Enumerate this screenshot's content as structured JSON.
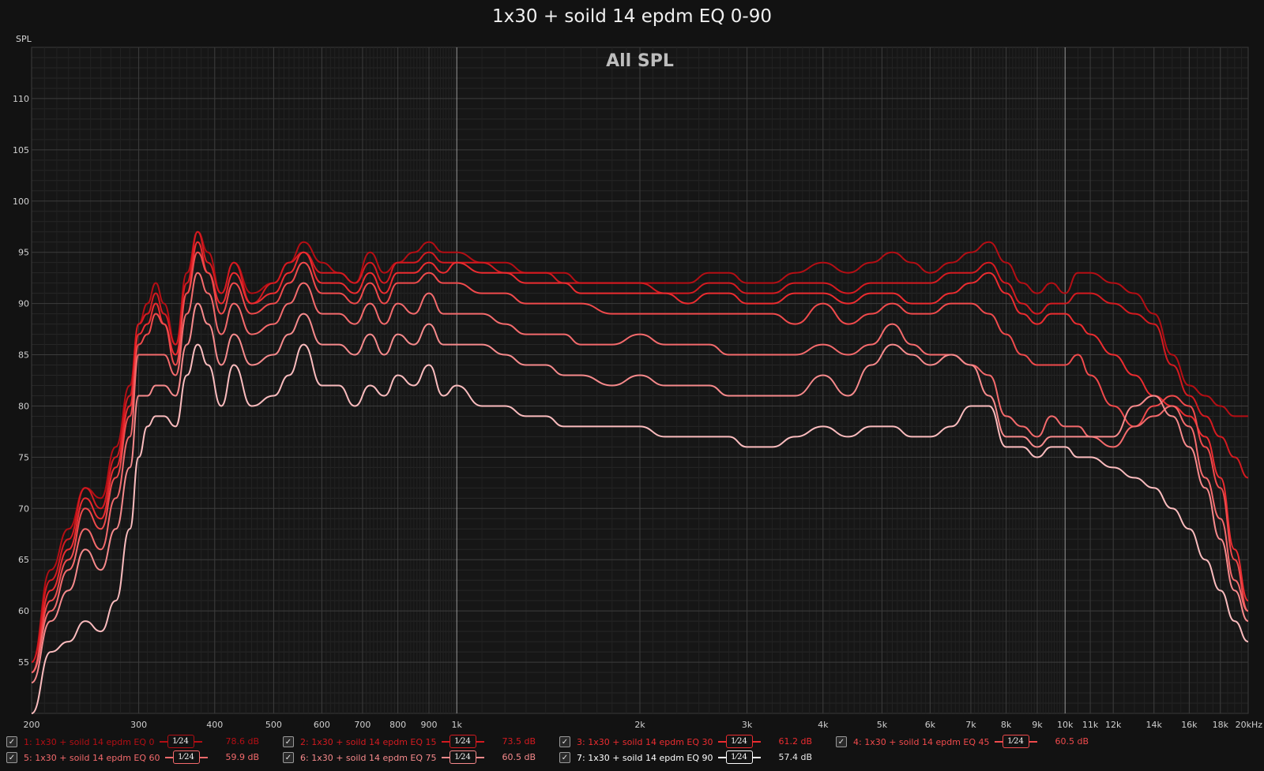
{
  "title": "1x30 + soild 14 epdm EQ 0-90",
  "chart_data": {
    "type": "line",
    "title": "1x30 + soild 14 epdm EQ 0-90",
    "subtitle": "All SPL",
    "ylabel": "SPL",
    "xlabel": "",
    "x_scale": "log",
    "xlim": [
      200,
      20000
    ],
    "ylim": [
      50,
      115
    ],
    "y_ticks": [
      55,
      60,
      65,
      70,
      75,
      80,
      85,
      90,
      95,
      100,
      105,
      110
    ],
    "x_ticks": [
      {
        "v": 200,
        "label": "200"
      },
      {
        "v": 300,
        "label": "300"
      },
      {
        "v": 400,
        "label": "400"
      },
      {
        "v": 500,
        "label": "500"
      },
      {
        "v": 600,
        "label": "600"
      },
      {
        "v": 700,
        "label": "700"
      },
      {
        "v": 800,
        "label": "800"
      },
      {
        "v": 900,
        "label": "900"
      },
      {
        "v": 1000,
        "label": "1k"
      },
      {
        "v": 2000,
        "label": "2k"
      },
      {
        "v": 3000,
        "label": "3k"
      },
      {
        "v": 4000,
        "label": "4k"
      },
      {
        "v": 5000,
        "label": "5k"
      },
      {
        "v": 6000,
        "label": "6k"
      },
      {
        "v": 7000,
        "label": "7k"
      },
      {
        "v": 8000,
        "label": "8k"
      },
      {
        "v": 9000,
        "label": "9k"
      },
      {
        "v": 10000,
        "label": "10k"
      },
      {
        "v": 11000,
        "label": "11k"
      },
      {
        "v": 12000,
        "label": "12k"
      },
      {
        "v": 14000,
        "label": "14k"
      },
      {
        "v": 16000,
        "label": "16k"
      },
      {
        "v": 18000,
        "label": "18k"
      },
      {
        "v": 20000,
        "label": "20kHz"
      }
    ],
    "grid": true,
    "x": [
      200,
      215,
      230,
      245,
      260,
      275,
      290,
      300,
      310,
      320,
      330,
      345,
      360,
      375,
      390,
      410,
      430,
      460,
      500,
      530,
      560,
      600,
      640,
      680,
      720,
      760,
      800,
      850,
      900,
      950,
      1000,
      1100,
      1200,
      1300,
      1400,
      1500,
      1600,
      1800,
      2000,
      2200,
      2400,
      2600,
      2800,
      3000,
      3300,
      3600,
      4000,
      4400,
      4800,
      5200,
      5600,
      6000,
      6500,
      7000,
      7500,
      8000,
      8500,
      9000,
      9500,
      10000,
      10500,
      11000,
      12000,
      13000,
      14000,
      15000,
      16000,
      17000,
      18000,
      19000,
      20000
    ],
    "series": [
      {
        "label": "1: 1x30 + soild 14 epdm EQ 0",
        "color": "#b40e14",
        "values": [
          55,
          64,
          68,
          72,
          71,
          76,
          82,
          88,
          90,
          92,
          90,
          86,
          93,
          97,
          95,
          91,
          94,
          91,
          92,
          94,
          96,
          94,
          93,
          92,
          95,
          93,
          94,
          95,
          96,
          95,
          95,
          94,
          94,
          93,
          93,
          93,
          92,
          92,
          92,
          92,
          92,
          93,
          93,
          92,
          92,
          93,
          94,
          93,
          94,
          95,
          94,
          93,
          94,
          95,
          96,
          94,
          92,
          91,
          92,
          91,
          93,
          93,
          92,
          91,
          89,
          85,
          82,
          81,
          80,
          79,
          79
        ]
      },
      {
        "label": "2: 1x30 + soild 14 epdm EQ 15",
        "color": "#d41a20",
        "values": [
          55,
          63,
          67,
          72,
          70,
          75,
          81,
          88,
          89,
          91,
          89,
          86,
          92,
          97,
          94,
          91,
          94,
          90,
          92,
          94,
          95,
          93,
          93,
          92,
          94,
          92,
          94,
          94,
          95,
          94,
          94,
          94,
          93,
          93,
          93,
          92,
          92,
          92,
          92,
          91,
          91,
          92,
          92,
          91,
          91,
          92,
          92,
          91,
          92,
          92,
          92,
          92,
          93,
          93,
          94,
          92,
          90,
          89,
          90,
          90,
          91,
          91,
          90,
          89,
          88,
          84,
          81,
          79,
          77,
          75,
          73
        ]
      },
      {
        "label": "3: 1x30 + soild 14 epdm EQ 30",
        "color": "#ec2c30",
        "values": [
          54,
          62,
          66,
          71,
          69,
          74,
          80,
          87,
          88,
          90,
          88,
          85,
          91,
          96,
          93,
          90,
          93,
          90,
          91,
          93,
          95,
          92,
          92,
          91,
          93,
          91,
          93,
          93,
          94,
          93,
          94,
          93,
          93,
          92,
          92,
          92,
          91,
          91,
          91,
          91,
          90,
          91,
          91,
          90,
          90,
          91,
          91,
          90,
          91,
          91,
          90,
          90,
          91,
          92,
          93,
          91,
          89,
          88,
          89,
          89,
          88,
          87,
          85,
          83,
          81,
          80,
          79,
          77,
          73,
          66,
          61
        ]
      },
      {
        "label": "4: 1x30 + soild 14 epdm EQ 45",
        "color": "#f04a4c",
        "values": [
          54,
          61,
          65,
          70,
          68,
          73,
          79,
          86,
          87,
          89,
          88,
          84,
          91,
          95,
          93,
          89,
          92,
          89,
          90,
          92,
          94,
          91,
          91,
          90,
          92,
          90,
          92,
          92,
          93,
          92,
          92,
          91,
          91,
          90,
          90,
          90,
          90,
          89,
          89,
          89,
          89,
          89,
          89,
          89,
          89,
          88,
          90,
          88,
          89,
          90,
          89,
          89,
          90,
          90,
          89,
          87,
          85,
          84,
          84,
          84,
          85,
          83,
          80,
          78,
          80,
          81,
          80,
          76,
          72,
          65,
          60
        ]
      },
      {
        "label": "5: 1x30 + soild 14 epdm EQ 60",
        "color": "#f46a6c",
        "values": [
          54,
          60,
          64,
          68,
          66,
          71,
          77,
          85,
          85,
          85,
          85,
          83,
          89,
          93,
          91,
          87,
          90,
          87,
          88,
          90,
          92,
          89,
          89,
          88,
          90,
          88,
          90,
          89,
          91,
          89,
          89,
          89,
          88,
          87,
          87,
          87,
          86,
          86,
          87,
          86,
          86,
          86,
          85,
          85,
          85,
          85,
          86,
          85,
          86,
          88,
          86,
          85,
          85,
          84,
          83,
          79,
          78,
          77,
          79,
          78,
          78,
          77,
          76,
          78,
          79,
          80,
          78,
          73,
          69,
          63,
          60
        ]
      },
      {
        "label": "6: 1x30 + soild 14 epdm EQ 75",
        "color": "#f78a8c",
        "values": [
          53,
          59,
          62,
          66,
          64,
          68,
          74,
          81,
          81,
          82,
          82,
          81,
          86,
          90,
          88,
          84,
          87,
          84,
          85,
          87,
          89,
          86,
          86,
          85,
          87,
          85,
          87,
          86,
          88,
          86,
          86,
          86,
          85,
          84,
          84,
          83,
          83,
          82,
          83,
          82,
          82,
          82,
          81,
          81,
          81,
          81,
          83,
          81,
          84,
          86,
          85,
          84,
          85,
          84,
          81,
          77,
          77,
          76,
          77,
          77,
          77,
          77,
          77,
          80,
          81,
          79,
          76,
          72,
          67,
          62,
          59
        ]
      },
      {
        "label": "7: 1x30 + soild 14 epdm EQ 90",
        "color": "#fbbcbe",
        "values": [
          46,
          56,
          57,
          59,
          58,
          61,
          68,
          75,
          78,
          79,
          79,
          78,
          83,
          86,
          84,
          80,
          84,
          80,
          81,
          83,
          86,
          82,
          82,
          80,
          82,
          81,
          83,
          82,
          84,
          81,
          82,
          80,
          80,
          79,
          79,
          78,
          78,
          78,
          78,
          77,
          77,
          77,
          77,
          76,
          76,
          77,
          78,
          77,
          78,
          78,
          77,
          77,
          78,
          80,
          80,
          76,
          76,
          75,
          76,
          76,
          75,
          75,
          74,
          73,
          72,
          70,
          68,
          65,
          62,
          59,
          57
        ]
      }
    ]
  },
  "legend": [
    {
      "label": "1: 1x30 + soild 14 epdm EQ 0",
      "smoothing": "1⁄24",
      "value": "78.6 dB",
      "color": "#b40e14"
    },
    {
      "label": "2: 1x30 + soild 14 epdm EQ 15",
      "smoothing": "1⁄24",
      "value": "73.5 dB",
      "color": "#d41a20"
    },
    {
      "label": "3: 1x30 + soild 14 epdm EQ 30",
      "smoothing": "1⁄24",
      "value": "61.2 dB",
      "color": "#ec2c30"
    },
    {
      "label": "4: 1x30 + soild 14 epdm EQ 45",
      "smoothing": "1⁄24",
      "value": "60.5 dB",
      "color": "#f04a4c"
    },
    {
      "label": "5: 1x30 + soild 14 epdm EQ 60",
      "smoothing": "1⁄24",
      "value": "59.9 dB",
      "color": "#f46a6c"
    },
    {
      "label": "6: 1x30 + soild 14 epdm EQ 75",
      "smoothing": "1⁄24",
      "value": "60.5 dB",
      "color": "#f78a8c"
    },
    {
      "label": "7: 1x30 + soild 14 epdm EQ 90",
      "smoothing": "1⁄24",
      "value": "57.4 dB",
      "color": "#ffffff"
    }
  ]
}
